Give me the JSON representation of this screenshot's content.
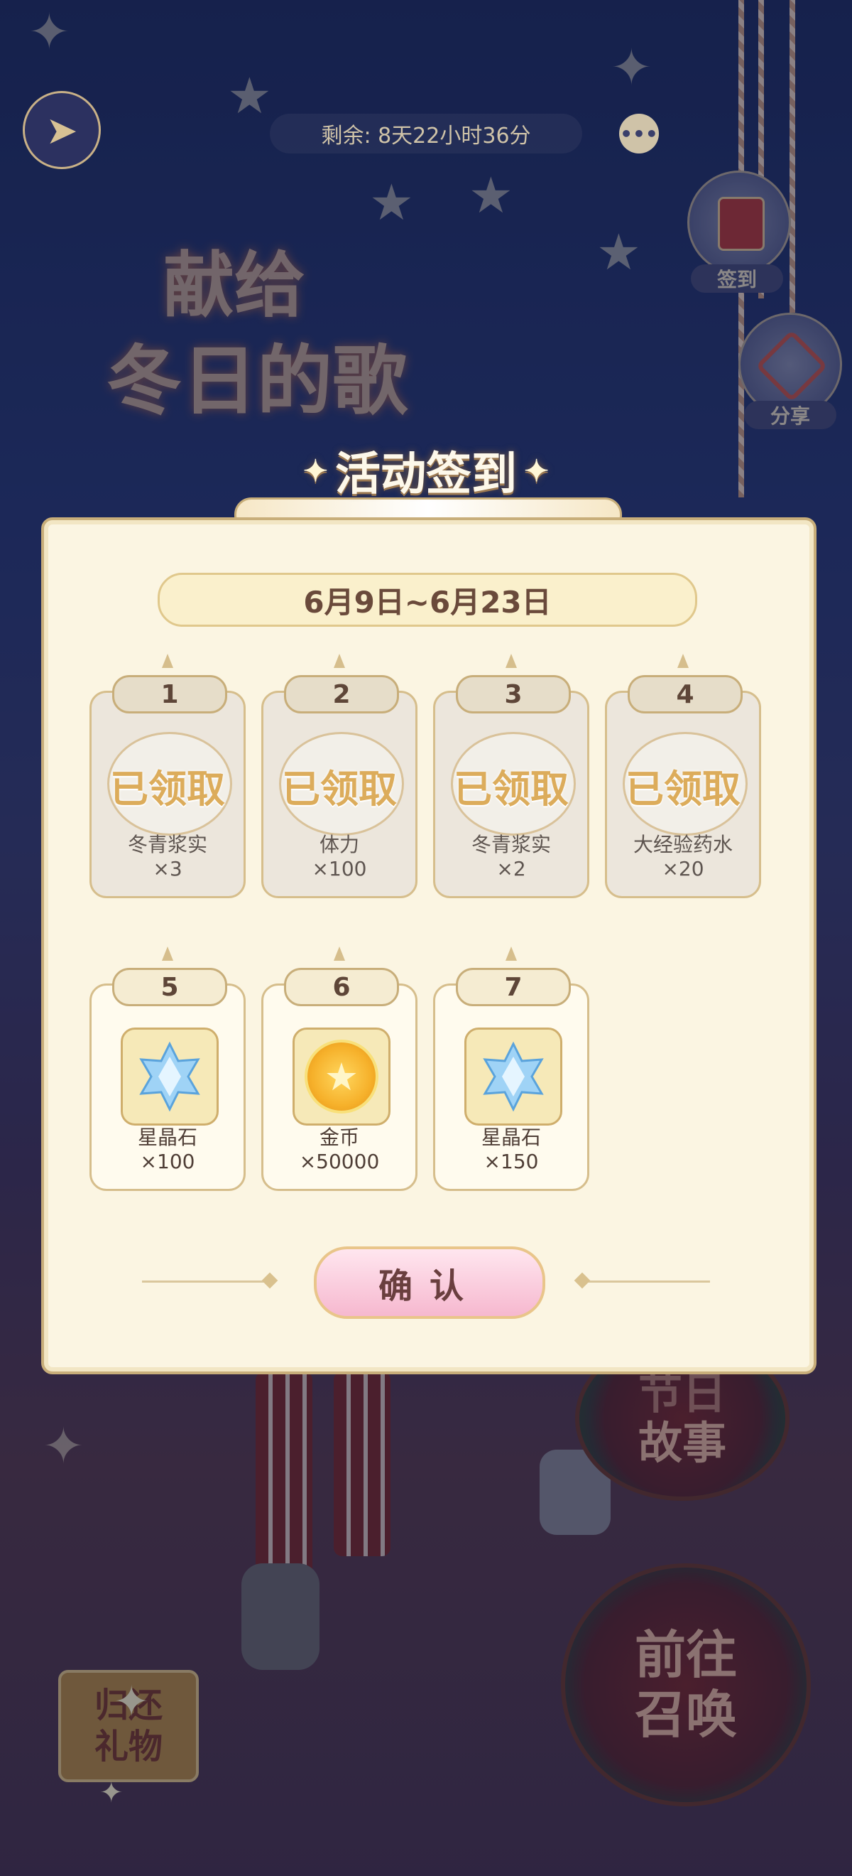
{
  "header": {
    "timer_text": "剩余: 8天22小时36分",
    "more_glyph": "•••"
  },
  "background": {
    "title_line1": "献给",
    "title_line2": "冬日的歌"
  },
  "side_buttons": [
    {
      "label": "签到",
      "icon": "sign-in-scroll-icon"
    },
    {
      "label": "分享",
      "icon": "share-icon"
    }
  ],
  "bottom_buttons": {
    "story": "故事",
    "story_partial": "节日",
    "summon_line1": "前往",
    "summon_line2": "召唤",
    "gift_line1": "归还",
    "gift_line2": "礼物"
  },
  "modal": {
    "title": "活动签到",
    "date_range": "6月9日~6月23日",
    "claimed_stamp": "已领取",
    "confirm_label": "确认",
    "days": [
      {
        "day": "1",
        "item": "冬青浆实",
        "qty": "×3",
        "claimed": true
      },
      {
        "day": "2",
        "item": "体力",
        "qty": "×100",
        "claimed": true
      },
      {
        "day": "3",
        "item": "冬青浆实",
        "qty": "×2",
        "claimed": true
      },
      {
        "day": "4",
        "item": "大经验药水",
        "qty": "×20",
        "claimed": true
      },
      {
        "day": "5",
        "item": "星晶石",
        "qty": "×100",
        "claimed": false,
        "icon": "star-crystal-icon"
      },
      {
        "day": "6",
        "item": "金币",
        "qty": "×50000",
        "claimed": false,
        "icon": "gold-coin-icon"
      },
      {
        "day": "7",
        "item": "星晶石",
        "qty": "×150",
        "claimed": false,
        "icon": "star-crystal-icon"
      }
    ]
  },
  "colors": {
    "panel_bg": "#fbf5e2",
    "panel_border": "#c8ae7a",
    "stamp_gold": "#dcac5b",
    "confirm_pink": "#f6b8cf"
  }
}
